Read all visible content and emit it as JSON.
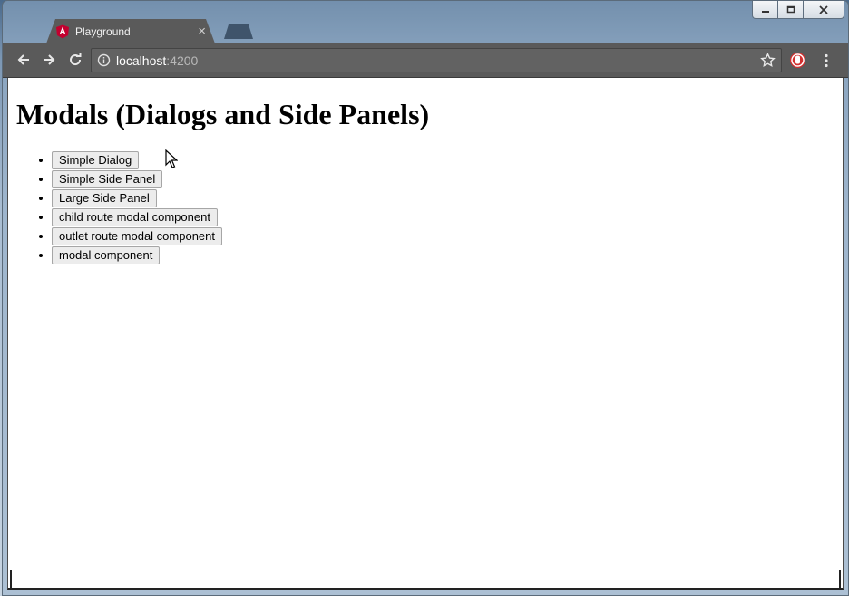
{
  "tab": {
    "title": "Playground",
    "close": "×"
  },
  "address": {
    "host": "localhost",
    "port": ":4200"
  },
  "page": {
    "title": "Modals (Dialogs and Side Panels)",
    "buttons": [
      "Simple Dialog",
      "Simple Side Panel",
      "Large Side Panel",
      "child route modal component",
      "outlet route modal component",
      "modal component"
    ]
  },
  "colors": {
    "chrome": "#5a5a5a",
    "angular_red": "#c3002f"
  },
  "icons": [
    "back-icon",
    "forward-icon",
    "reload-icon",
    "info-icon",
    "star-icon",
    "extension-icon",
    "menu-icon",
    "angular-icon",
    "minimize-icon",
    "maximize-icon",
    "close-icon"
  ]
}
